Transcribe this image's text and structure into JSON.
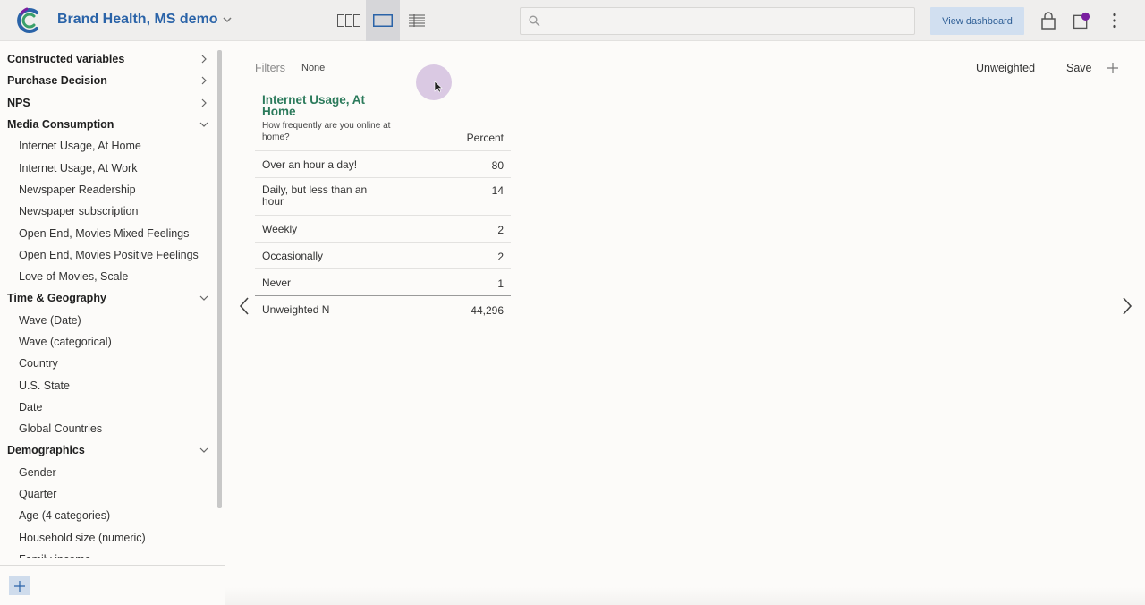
{
  "header": {
    "app_title": "Brand Health, MS demo",
    "search_placeholder": "",
    "view_dashboard_label": "View dashboard",
    "active_view": "single-table"
  },
  "sidebar": {
    "items": [
      {
        "label": "Constructed variables",
        "type": "category",
        "state": "collapsed"
      },
      {
        "label": "Purchase Decision",
        "type": "category",
        "state": "collapsed"
      },
      {
        "label": "NPS",
        "type": "category",
        "state": "collapsed"
      },
      {
        "label": "Media Consumption",
        "type": "category",
        "state": "expanded"
      },
      {
        "label": "Internet Usage, At Home",
        "type": "variable"
      },
      {
        "label": "Internet Usage, At Work",
        "type": "variable"
      },
      {
        "label": "Newspaper Readership",
        "type": "variable"
      },
      {
        "label": "Newspaper subscription",
        "type": "variable"
      },
      {
        "label": "Open End, Movies Mixed Feelings",
        "type": "variable"
      },
      {
        "label": "Open End, Movies Positive Feelings",
        "type": "variable"
      },
      {
        "label": "Love of Movies, Scale",
        "type": "variable"
      },
      {
        "label": "Time & Geography",
        "type": "category",
        "state": "expanded"
      },
      {
        "label": "Wave (Date)",
        "type": "variable"
      },
      {
        "label": "Wave (categorical)",
        "type": "variable"
      },
      {
        "label": "Country",
        "type": "variable"
      },
      {
        "label": "U.S. State",
        "type": "variable"
      },
      {
        "label": "Date",
        "type": "variable"
      },
      {
        "label": "Global Countries",
        "type": "variable"
      },
      {
        "label": "Demographics",
        "type": "category",
        "state": "expanded"
      },
      {
        "label": "Gender",
        "type": "variable"
      },
      {
        "label": "Quarter",
        "type": "variable"
      },
      {
        "label": "Age (4 categories)",
        "type": "variable"
      },
      {
        "label": "Household size (numeric)",
        "type": "variable"
      },
      {
        "label": "Family income",
        "type": "variable"
      }
    ]
  },
  "main": {
    "filters_label": "Filters",
    "filters_value": "None",
    "weighting_label": "Unweighted",
    "save_label": "Save",
    "table": {
      "title": "Internet Usage, At Home",
      "question": "How frequently are you online at home?",
      "column_header": "Percent",
      "rows": [
        {
          "label": "Over an hour a day!",
          "value": "80"
        },
        {
          "label": "Daily, but less than an hour",
          "value": "14"
        },
        {
          "label": "Weekly",
          "value": "2"
        },
        {
          "label": "Occasionally",
          "value": "2"
        },
        {
          "label": "Never",
          "value": "1"
        }
      ],
      "total_row": {
        "label": "Unweighted N",
        "value": "44,296"
      }
    }
  },
  "colors": {
    "brand_blue": "#2a63a8",
    "title_green": "#2b7a5b",
    "notification_dot": "#7a1fa0"
  }
}
